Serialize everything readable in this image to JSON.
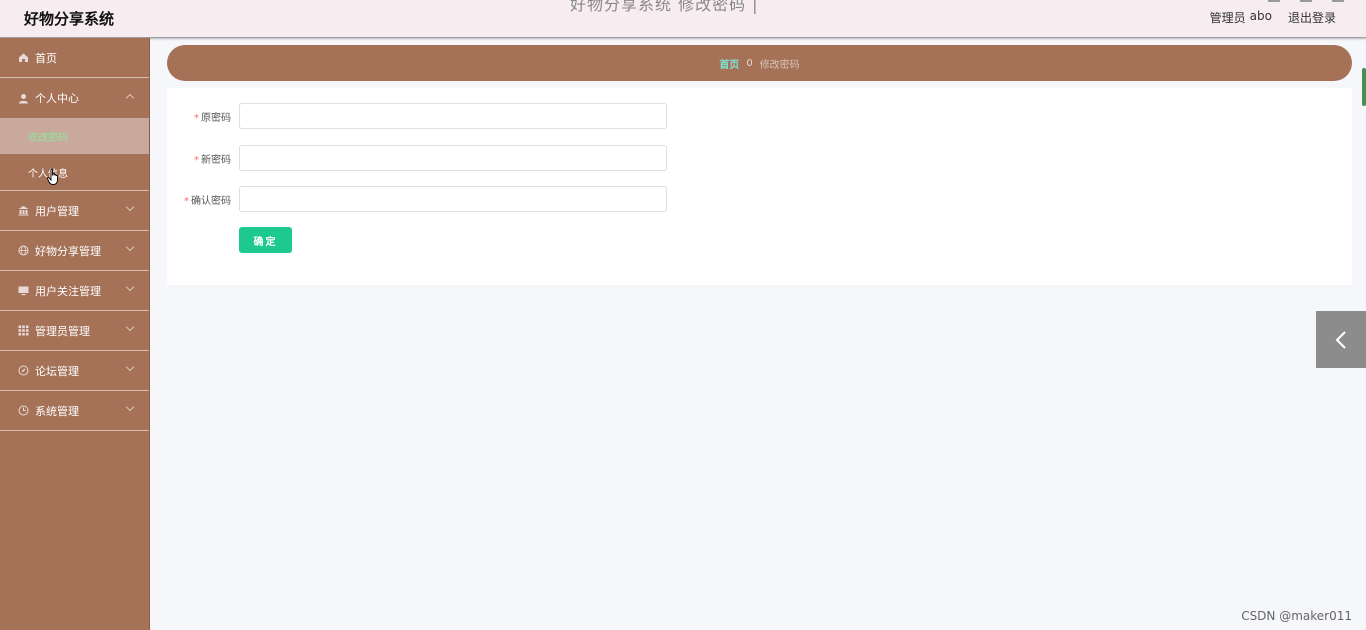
{
  "header": {
    "app_title": "好物分享系统",
    "partial_title": "好物分享系统 修改密码 |",
    "role": "管理员",
    "username": "abo",
    "logout": "退出登录"
  },
  "sidebar": {
    "items": [
      {
        "label": "首页",
        "icon": "home-icon"
      },
      {
        "label": "个人中心",
        "icon": "user-icon",
        "expanded": true,
        "children": [
          {
            "label": "修改密码",
            "active": true
          },
          {
            "label": "个人信息"
          }
        ]
      },
      {
        "label": "用户管理",
        "icon": "bank-icon"
      },
      {
        "label": "好物分享管理",
        "icon": "globe-icon"
      },
      {
        "label": "用户关注管理",
        "icon": "monitor-icon"
      },
      {
        "label": "管理员管理",
        "icon": "grid-icon"
      },
      {
        "label": "论坛管理",
        "icon": "compass-icon"
      },
      {
        "label": "系统管理",
        "icon": "clock-icon"
      }
    ]
  },
  "breadcrumb": {
    "home": "首页",
    "separator": "0",
    "current": "修改密码"
  },
  "form": {
    "fields": [
      {
        "label": "原密码",
        "value": "",
        "required": true
      },
      {
        "label": "新密码",
        "value": "",
        "required": true
      },
      {
        "label": "确认密码",
        "value": "",
        "required": true
      }
    ],
    "required_mark": "*",
    "submit": "确定"
  },
  "watermark": "CSDN @maker011",
  "colors": {
    "sidebar_bg": "#a57257",
    "header_bg": "#f7edf0",
    "active_text": "#8ee89c",
    "button": "#1ec98f",
    "breadcrumb_home": "#7fe3d8"
  }
}
